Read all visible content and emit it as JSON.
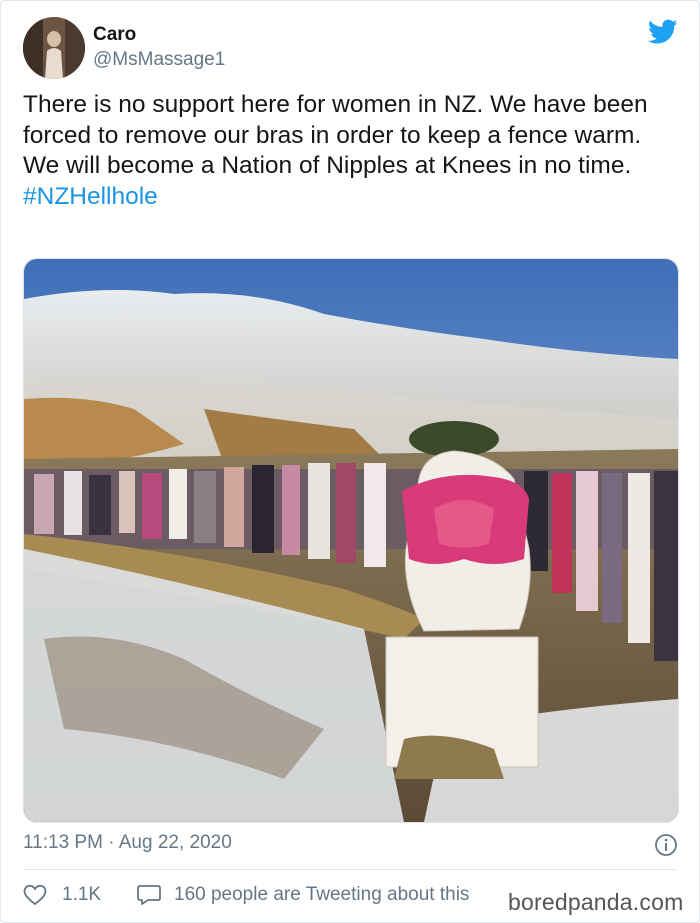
{
  "user": {
    "display_name": "Caro",
    "handle": "@MsMassage1"
  },
  "tweet": {
    "text": "There is no support here for women in NZ. We have been forced to remove our bras in order to keep a fence warm. We will become a Nation of Nipples at Knees in no time.",
    "hashtag": "#NZHellhole"
  },
  "meta": {
    "timestamp": "11:13 PM · Aug 22, 2020",
    "likes": "1.1K",
    "tweeting_text": "160 people are Tweeting about this"
  },
  "watermark": "boredpanda.com",
  "icons": {
    "brand": "twitter-bird-icon",
    "info": "info-icon",
    "like": "heart-icon",
    "reply": "speech-bubble-icon"
  },
  "colors": {
    "brand_blue": "#1da1f2",
    "hashtag_blue": "#1b95e0",
    "secondary_text": "#657786"
  }
}
